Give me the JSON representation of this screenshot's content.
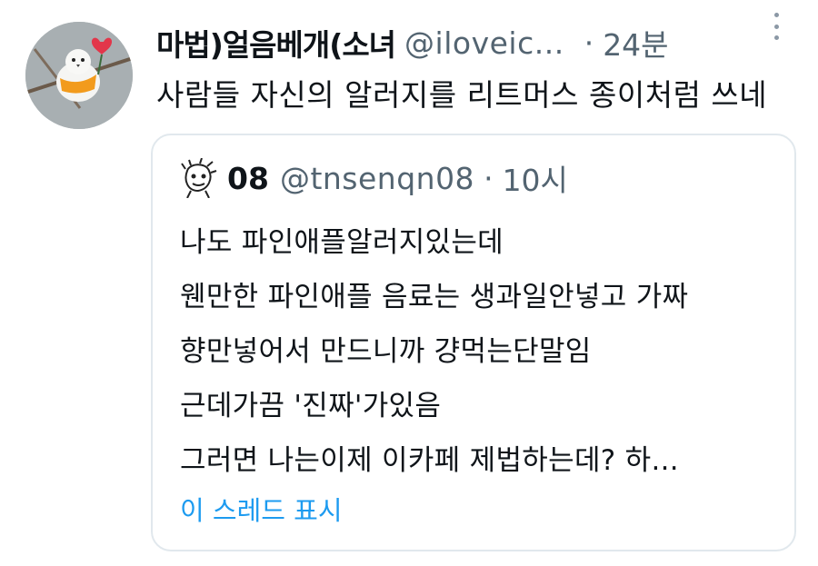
{
  "tweet": {
    "author": {
      "display_name": "마법)얼음베개(소녀",
      "handle": "@iloveic...",
      "avatar_icon": "bird-avatar-icon"
    },
    "separator": "·",
    "time": "24분",
    "more_icon": "more-vertical-icon",
    "text": "사람들 자신의 알러지를 리트머스 종이처럼 쓰네",
    "quote": {
      "author": {
        "display_name": "08",
        "handle": "@tnsenqn08",
        "avatar_icon": "sketch-avatar-icon"
      },
      "separator": "·",
      "time": "10시",
      "lines": [
        "나도 파인애플알러지있는데",
        "웬만한 파인애플 음료는 생과일안넣고 가짜",
        "향만넣어서 만드니까 걍먹는단말임",
        "근데가끔 '진짜'가있음",
        "그러면 나는이제 이카페 제법하는데? 하..."
      ],
      "show_thread": "이 스레드 표시"
    }
  },
  "colors": {
    "text_primary": "#0f1419",
    "text_secondary": "#536471",
    "link": "#1d9bf0",
    "border": "#e1e8ed"
  }
}
